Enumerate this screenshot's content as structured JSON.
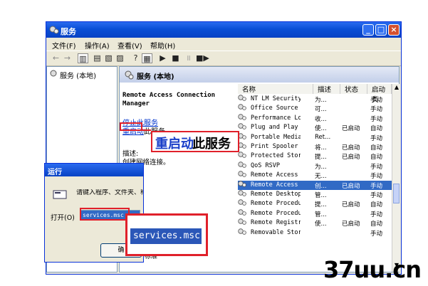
{
  "window": {
    "title": "服务",
    "menu": [
      "文件(F)",
      "操作(A)",
      "查看(V)",
      "帮助(H)"
    ],
    "title_color": "#0a4fd6"
  },
  "tree": {
    "root": "服务 (本地)"
  },
  "pane": {
    "header": "服务 (本地)",
    "service_name": "Remote Access Connection Manager",
    "stop_link": "停止此服务",
    "restart_link": "重启动",
    "restart_suffix": "此服务",
    "desc_label": "描述:",
    "desc_text": "创建网络连接。"
  },
  "list": {
    "columns": [
      "名称",
      "描述",
      "状态",
      "启动类"
    ],
    "rows": [
      {
        "name": "NT LM Security...",
        "desc": "为...",
        "status": "",
        "startup": "手动"
      },
      {
        "name": "Office Source ...",
        "desc": "可...",
        "status": "",
        "startup": "手动"
      },
      {
        "name": "Performance Lo...",
        "desc": "收...",
        "status": "",
        "startup": "手动"
      },
      {
        "name": "Plug and Play",
        "desc": "使...",
        "status": "已启动",
        "startup": "自动"
      },
      {
        "name": "Portable Media...",
        "desc": "Ret...",
        "status": "",
        "startup": "手动"
      },
      {
        "name": "Print Spooler",
        "desc": "将...",
        "status": "已启动",
        "startup": "自动"
      },
      {
        "name": "Protected Storage",
        "desc": "提...",
        "status": "已启动",
        "startup": "自动"
      },
      {
        "name": "QoS RSVP",
        "desc": "为...",
        "status": "",
        "startup": "手动"
      },
      {
        "name": "Remote Access ...",
        "desc": "无...",
        "status": "",
        "startup": "手动"
      },
      {
        "name": "Remote Access ...",
        "desc": "创...",
        "status": "已启动",
        "startup": "手动",
        "selected": true
      },
      {
        "name": "Remote Desktop...",
        "desc": "管...",
        "status": "",
        "startup": "手动"
      },
      {
        "name": "Remote Procedu...",
        "desc": "提...",
        "status": "已启动",
        "startup": "自动"
      },
      {
        "name": "Remote Procedu...",
        "desc": "管...",
        "status": "",
        "startup": "手动"
      },
      {
        "name": "Remote Registry",
        "desc": "使...",
        "status": "已启动",
        "startup": "自动"
      },
      {
        "name": "Removable Storage",
        "desc": "",
        "status": "",
        "startup": "手动"
      }
    ]
  },
  "tabs": {
    "standard": "标准"
  },
  "run_dialog": {
    "title": "运行",
    "prompt": "请键入程序、文件夹、称，Windows 将为您打",
    "open_label": "打开(O)",
    "input_value": "services.msc",
    "button_fragment": "确"
  },
  "callouts": {
    "restart_big_blue": "重启动",
    "restart_big_black": "此服务",
    "command_big": "services.msc"
  },
  "watermark": "37uu.cn"
}
